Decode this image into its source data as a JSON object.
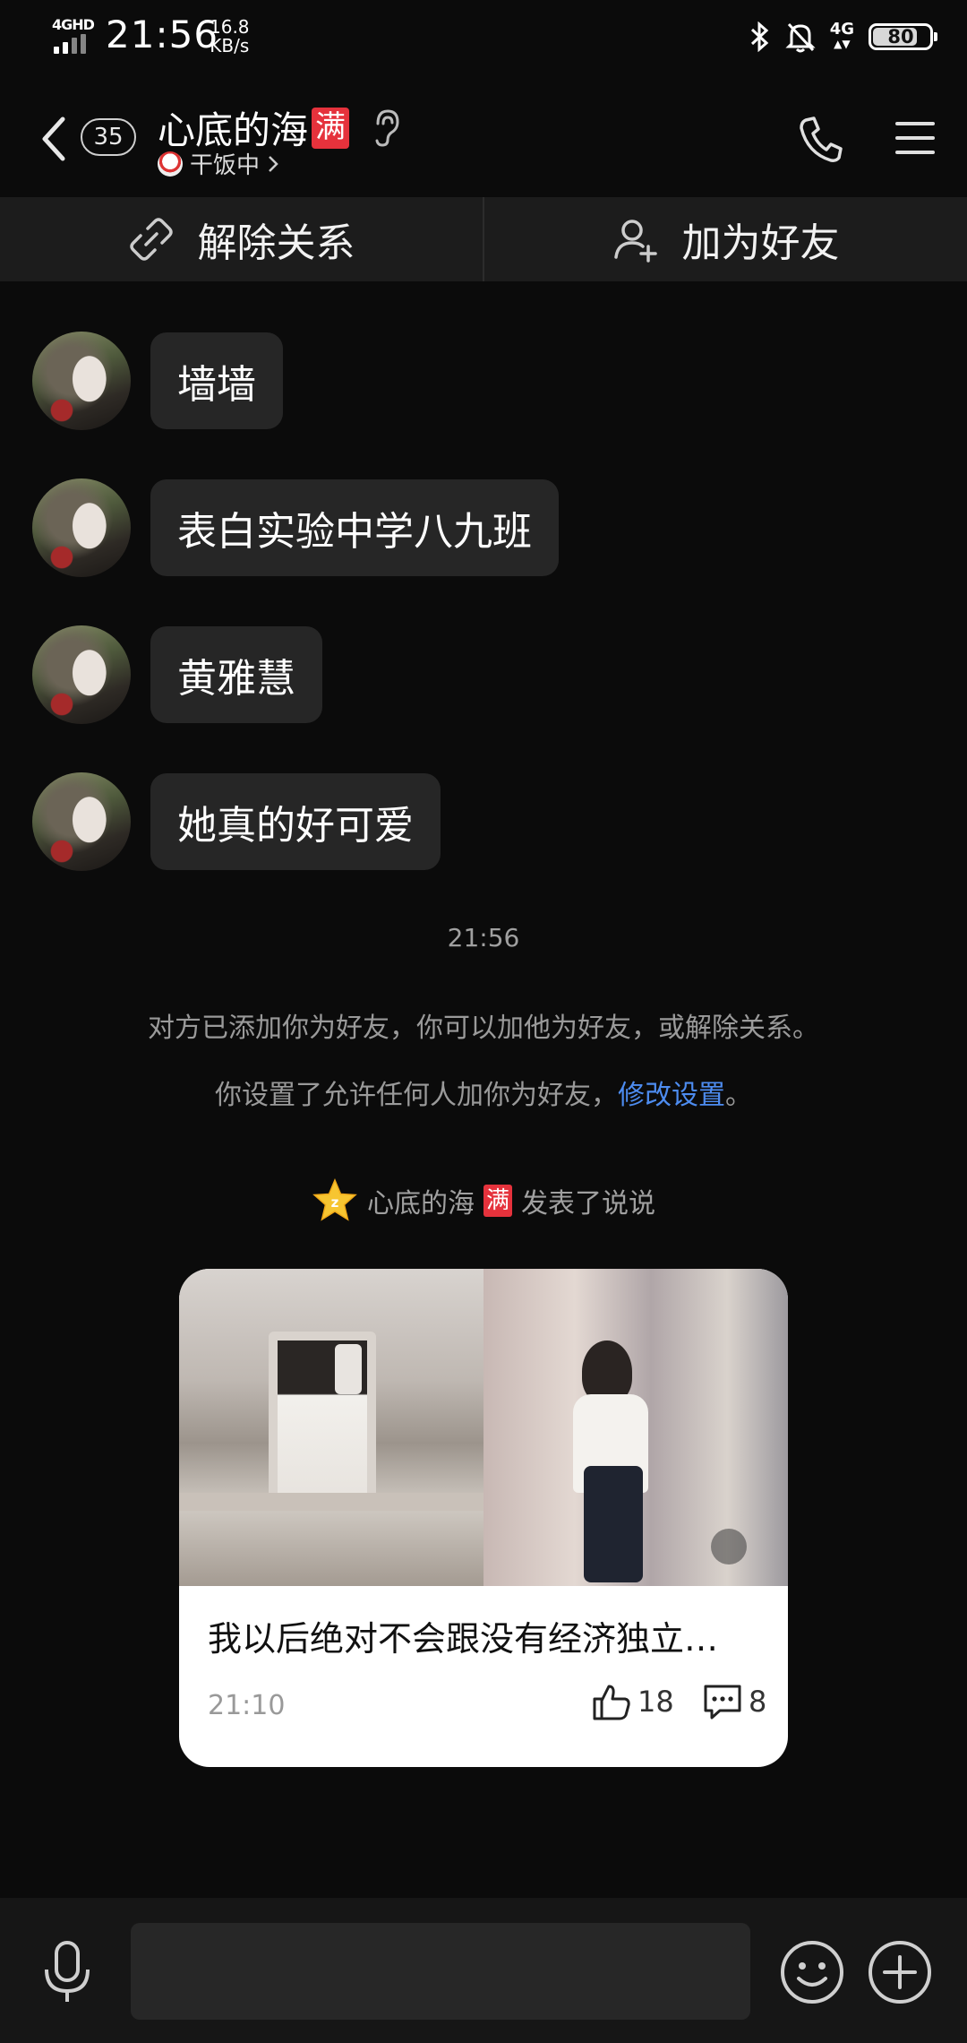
{
  "status_bar": {
    "network": "4GHD",
    "time": "21:56",
    "speed_value": "16.8",
    "speed_unit": "KB/s",
    "network_right": "4G",
    "battery": "80",
    "battery_level": 0.8
  },
  "header": {
    "unread_count": "35",
    "contact_name": "心底的海",
    "vip_tag": "满",
    "status": "干饭中",
    "icons": [
      "back-icon",
      "ear-icon",
      "phone-icon",
      "menu-icon"
    ]
  },
  "actions": {
    "remove_relation": "解除关系",
    "add_friend": "加为好友"
  },
  "messages": [
    {
      "text": "墙墙"
    },
    {
      "text": "表白实验中学八九班"
    },
    {
      "text": "黄雅慧"
    },
    {
      "text": "她真的好可爱"
    }
  ],
  "timestamp": "21:56",
  "system": {
    "line1": "对方已添加你为好友，你可以加他为好友，或解除关系。",
    "line2_prefix": "你设置了允许任何人加你为好友，",
    "line2_link": "修改设置",
    "line2_suffix": "。"
  },
  "qzone": {
    "name": "心底的海",
    "vip_tag": "满",
    "action": "发表了说说"
  },
  "post": {
    "text": "我以后绝对不会跟没有经济独立…",
    "time": "21:10",
    "likes": "18",
    "comments": "8"
  },
  "input": {
    "placeholder": ""
  },
  "colors": {
    "background": "#0b0b0b",
    "bubble": "#262626",
    "vip": "#e5323c",
    "link": "#4d8cf0"
  }
}
